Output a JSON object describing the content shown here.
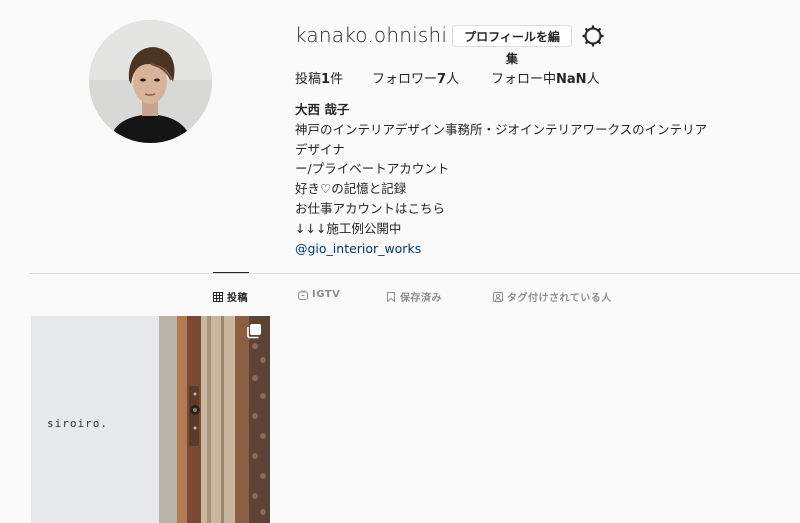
{
  "profile": {
    "username": "kanako.ohnishi",
    "edit_button_label": "プロフィールを編集",
    "settings_icon": "gear-icon",
    "stats": {
      "posts_label": "投稿",
      "posts_count": "1",
      "posts_suffix": "件",
      "followers_label": "フォロワー",
      "followers_count": "7",
      "followers_suffix": "人",
      "following_label": "フォロー中",
      "following_count": "NaN",
      "following_suffix": "人"
    },
    "bio": {
      "name": "大西 哉子",
      "line1": "神戸のインテリアデザイン事務所・ジオインテリアワークスのインテリアデザイナ",
      "line2": "ー/プライベートアカウント",
      "line3": "好き♡の記憶と記録",
      "line4": "お仕事アカウントはこちら",
      "line5": "↓↓↓施工例公開中",
      "mention": "@gio_interior_works"
    }
  },
  "tabs": [
    {
      "label": "投稿",
      "icon": "grid-icon",
      "active": true
    },
    {
      "label": "IGTV",
      "icon": "igtv-icon",
      "active": false
    },
    {
      "label": "保存済み",
      "icon": "bookmark-icon",
      "active": false
    },
    {
      "label": "タグ付けされている人",
      "icon": "tag-person-icon",
      "active": false
    }
  ],
  "posts": [
    {
      "overlay_text": "siroiro.",
      "icon": "multiple-images-icon"
    }
  ],
  "colors": {
    "background": "#fafafa",
    "text": "#262626",
    "muted": "#8e8e8e",
    "link": "#00376b",
    "border": "#dbdbdb"
  }
}
